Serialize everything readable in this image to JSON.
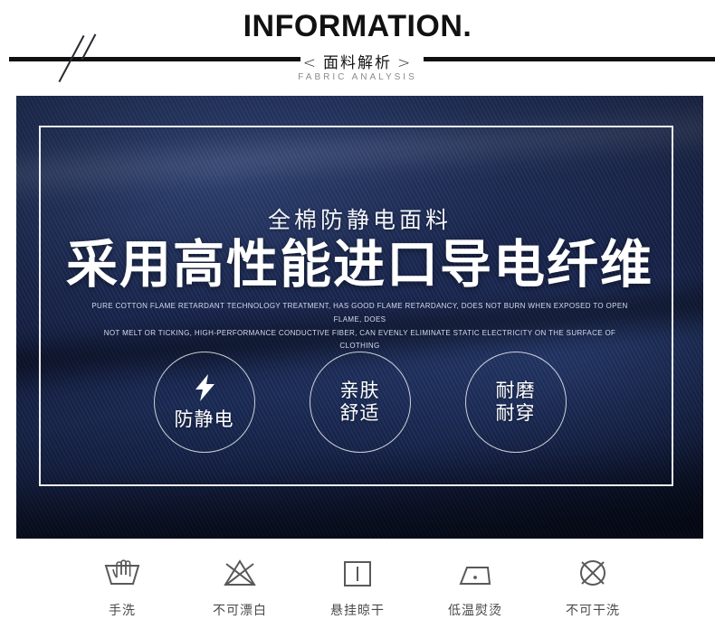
{
  "header": {
    "title": "INFORMATION.",
    "subtitle_cn": "面料解析",
    "bracket_left": "<",
    "bracket_right": ">",
    "subtitle_en": "FABRIC ANALYSIS"
  },
  "panel": {
    "kicker": "全棉防静电面料",
    "headline": "采用高性能进口导电纤维",
    "desc_line1": "PURE COTTON FLAME RETARDANT TECHNOLOGY TREATMENT, HAS GOOD FLAME RETARDANCY, DOES NOT BURN WHEN EXPOSED TO OPEN FLAME, DOES",
    "desc_line2": "NOT MELT OR TICKING, HIGH-PERFORMANCE CONDUCTIVE FIBER, CAN EVENLY ELIMINATE STATIC ELECTRICITY ON THE SURFACE OF CLOTHING",
    "badges": [
      {
        "icon": "lightning-bolt-icon",
        "label": "防静电",
        "line1": "防静电",
        "line2": ""
      },
      {
        "icon": "",
        "label": "亲肤舒适",
        "line1": "亲肤",
        "line2": "舒适"
      },
      {
        "icon": "",
        "label": "耐磨耐穿",
        "line1": "耐磨",
        "line2": "耐穿"
      }
    ]
  },
  "care_instructions": [
    {
      "icon": "hand-wash-icon",
      "label": "手洗"
    },
    {
      "icon": "no-bleach-icon",
      "label": "不可漂白"
    },
    {
      "icon": "hang-dry-icon",
      "label": "悬挂晾干"
    },
    {
      "icon": "low-heat-iron-icon",
      "label": "低温熨烫"
    },
    {
      "icon": "no-dry-clean-icon",
      "label": "不可干洗"
    }
  ],
  "colors": {
    "panel_dark": "#101b3e",
    "panel_blue": "#1c2a52",
    "rule_black": "#101010",
    "care_gray": "#4a4a4a",
    "white": "#ffffff"
  }
}
